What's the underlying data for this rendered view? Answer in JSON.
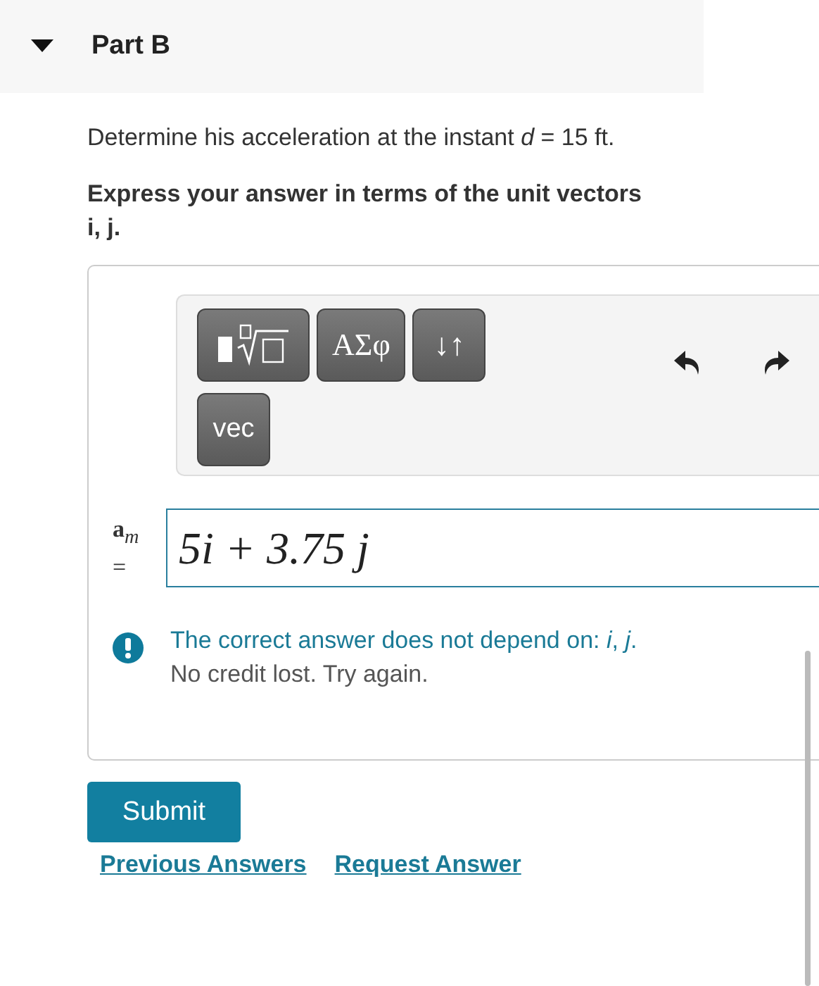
{
  "part": {
    "title": "Part B",
    "expanded": true
  },
  "question": "Determine his acceleration at the instant *d* = 15 ft.",
  "instruction": "Express your answer in terms of the unit vectors i, j.",
  "toolbar": {
    "buttons": [
      {
        "kind": "template"
      },
      {
        "kind": "text",
        "label": "ΑΣφ"
      },
      {
        "kind": "text",
        "label": "↓↑"
      }
    ],
    "second_row": [
      {
        "kind": "text",
        "label": "vec"
      }
    ]
  },
  "answer": {
    "label": "**a**$_{m}$ =",
    "value": "5i + 3.75 j"
  },
  "feedback": {
    "message": "The correct answer does not depend on: *i*, *j*.",
    "note": "No credit lost. Try again."
  },
  "submit": "Submit",
  "links": [
    "Previous Answers",
    "Request Answer"
  ]
}
